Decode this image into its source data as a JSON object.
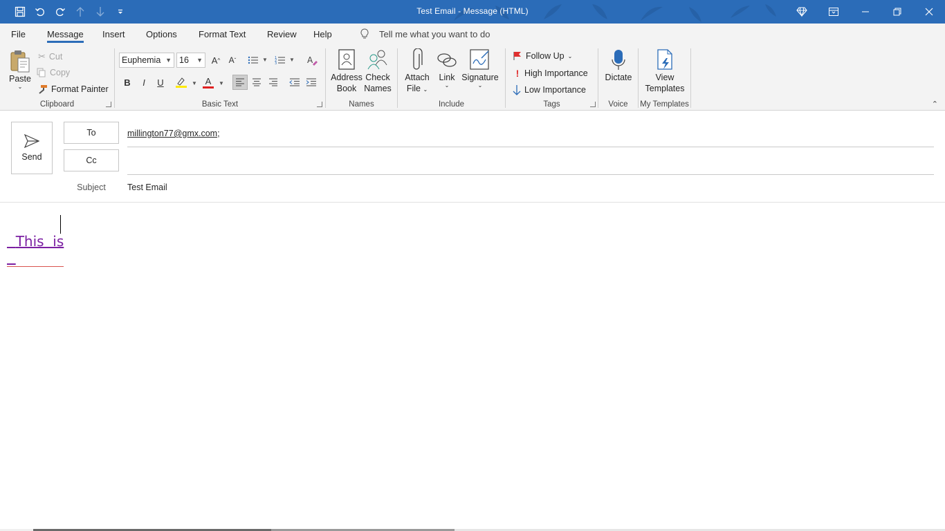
{
  "window": {
    "title": "Test Email  -  Message (HTML)",
    "accent": "#2b6cb8"
  },
  "qat": {
    "icons": [
      "save-icon",
      "undo-icon",
      "redo-icon",
      "up-arrow-icon",
      "down-arrow-icon",
      "customize-qat-icon"
    ]
  },
  "menu": {
    "tabs": [
      "File",
      "Message",
      "Insert",
      "Options",
      "Format Text",
      "Review",
      "Help"
    ],
    "active": "Message",
    "tell_me": "Tell me what you want to do"
  },
  "ribbon": {
    "clipboard": {
      "label": "Clipboard",
      "paste": "Paste",
      "cut": "Cut",
      "copy": "Copy",
      "format_painter": "Format Painter"
    },
    "basic_text": {
      "label": "Basic Text",
      "font": "Euphemia",
      "size": "16",
      "bold": "B",
      "italic": "I",
      "underline": "U",
      "font_color": "A"
    },
    "names": {
      "label": "Names",
      "address_book": [
        "Address",
        "Book"
      ],
      "check_names": [
        "Check",
        "Names"
      ]
    },
    "include": {
      "label": "Include",
      "attach": [
        "Attach",
        "File"
      ],
      "link": "Link",
      "signature": "Signature"
    },
    "tags": {
      "label": "Tags",
      "follow_up": "Follow Up",
      "high": "High Importance",
      "low": "Low Importance"
    },
    "voice": {
      "label": "Voice",
      "dictate": "Dictate"
    },
    "templates": {
      "label": "My Templates",
      "view": [
        "View",
        "Templates"
      ]
    }
  },
  "compose": {
    "send": "Send",
    "to_label": "To",
    "cc_label": "Cc",
    "to_value": "millington77@gmx.com;",
    "cc_value": "",
    "subject_label": "Subject",
    "subject_value": "Test Email",
    "body": "This  is"
  }
}
